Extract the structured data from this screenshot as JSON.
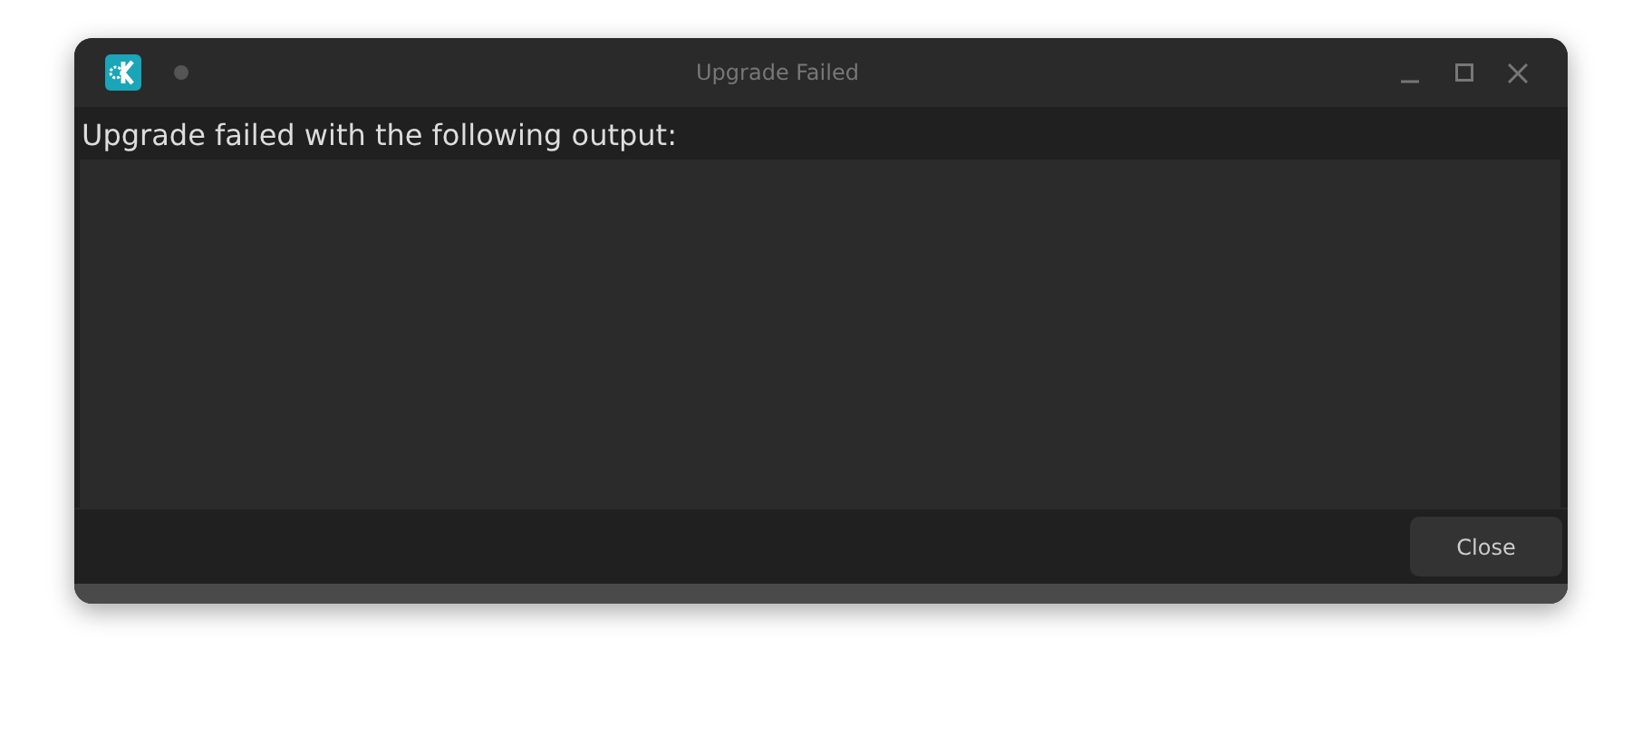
{
  "window": {
    "title": "Upgrade Failed"
  },
  "message": "Upgrade failed with the following output:",
  "buttons": [
    {
      "label": "Close"
    }
  ]
}
